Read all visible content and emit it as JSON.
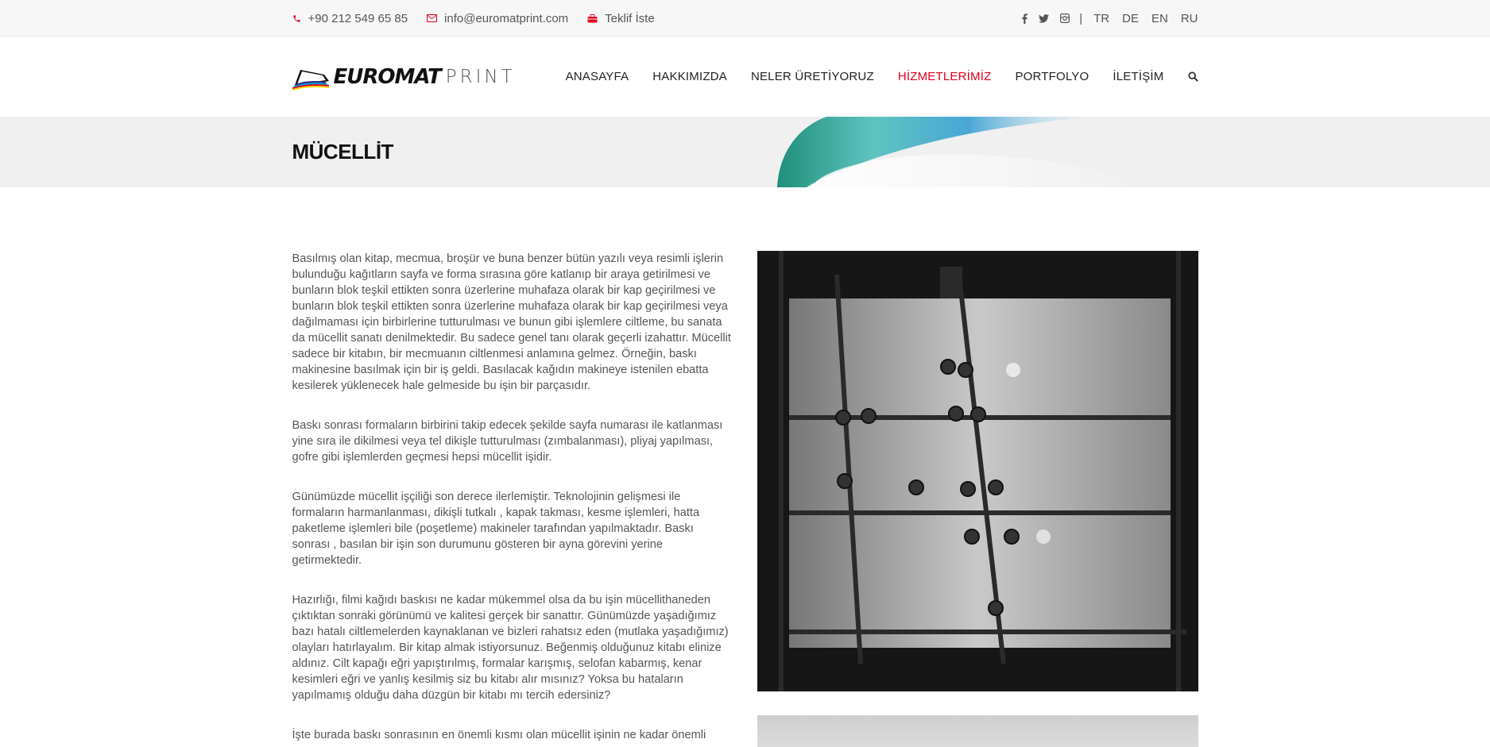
{
  "topbar": {
    "phone": "+90 212 549 65 85",
    "email": "info@euromatprint.com",
    "quote": "Teklif İste",
    "separator": "|",
    "languages": [
      "TR",
      "DE",
      "EN",
      "RU"
    ],
    "social_icons": [
      "facebook-icon",
      "twitter-icon",
      "instagram-icon"
    ]
  },
  "logo": {
    "bold": "EUROMAT",
    "light": "PRINT"
  },
  "nav": {
    "items": [
      {
        "label": "ANASAYFA"
      },
      {
        "label": "HAKKIMIZDA"
      },
      {
        "label": "NELER ÜRETİYORUZ"
      },
      {
        "label": "HİZMETLERİMİZ"
      },
      {
        "label": "PORTFOLYO"
      },
      {
        "label": "İLETİŞİM"
      }
    ],
    "active_index": 3
  },
  "page": {
    "title": "MÜCELLİT"
  },
  "content": {
    "paragraphs": [
      "Basılmış olan kitap, mecmua, broşür ve buna benzer bütün yazılı veya resimli işlerin bulunduğu kağıtların sayfa ve forma sırasına göre katlanıp bir araya getirilmesi ve bunların blok teşkil ettikten sonra üzerlerine muhafaza olarak bir kap geçirilmesi ve bunların blok teşkil ettikten sonra üzerlerine muhafaza olarak bir kap geçirilmesi veya dağılmaması için birbirlerine tutturulması ve bunun gibi işlemlere ciltleme, bu sanata da mücellit sanatı denilmektedir. Bu sadece genel tanı olarak geçerli izahattır. Mücellit sadece bir kitabın, bir mecmuanın ciltlenmesi anlamına gelmez. Örneğin, baskı makinesine basılmak için bir iş geldi. Basılacak kağıdın makineye istenilen ebatta kesilerek yüklenecek hale gelmeside bu işin bir parçasıdır.",
      "Baskı sonrası formaların birbirini takip edecek şekilde sayfa numarası ile katlanması yine sıra ile dikilmesi veya tel dikişle tutturulması (zımbalanması), pliyaj yapılması, gofre gibi işlemlerden geçmesi hepsi mücellit işidir.",
      "Günümüzde mücellit işçiliği son derece ilerlemiştir. Teknolojinin gelişmesi ile formaların harmanlanması, dikişli tutkalı , kapak takması, kesme işlemleri, hatta paketleme işlemleri bile (poşetleme) makineler tarafından yapılmaktadır. Baskı sonrası , basılan bir işin son durumunu gösteren bir ayna görevini yerine getirmektedir.",
      "Hazırlığı, filmi kağıdı baskısı ne kadar mükemmel olsa da bu işin mücellithaneden çıktıktan sonraki görünümü ve kalitesi gerçek bir sanattır. Günümüzde yaşadığımız bazı hatalı ciltlemelerden kaynaklanan ve bizleri rahatsız eden (mutlaka yaşadığımız) olayları hatırlayalım. Bir kitap almak istiyorsunuz. Beğenmiş olduğunuz kitabı elinize aldınız. Cilt kapağı eğri yapıştırılmış, formalar karışmış, selofan kabarmış, kenar kesimleri eğri ve yanlış kesilmiş siz bu kitabı alır mısınız? Yoksa bu hataların yapılmamış olduğu daha düzgün bir kitabı mı tercih edersiniz?",
      "İşte burada baskı sonrasının en önemli kısmı olan mücellit işinin ne kadar önemli"
    ]
  },
  "colors": {
    "accent": "#e2001a",
    "titlebar_bg": "#f0f0f0",
    "topbar_bg": "#f7f7f7"
  }
}
